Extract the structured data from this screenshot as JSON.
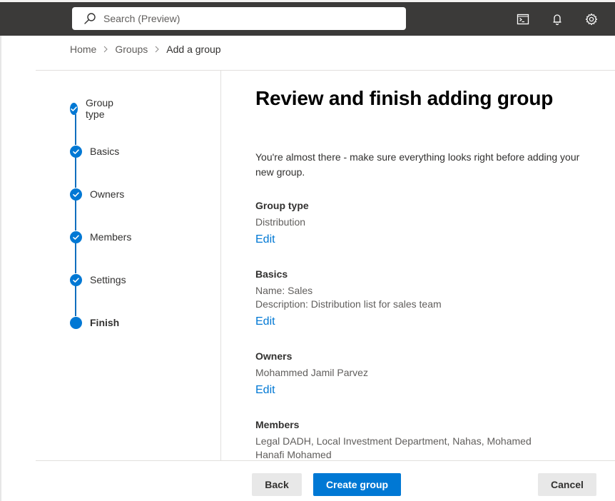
{
  "topbar": {
    "search": {
      "placeholder": "Search (Preview)",
      "icon": "search-icon"
    },
    "icons": [
      {
        "name": "cloud-shell-icon",
        "label": "Cloud shell"
      },
      {
        "name": "notifications-bell-icon",
        "label": "Notifications"
      },
      {
        "name": "settings-gear-icon",
        "label": "Settings"
      }
    ]
  },
  "breadcrumb": {
    "items": [
      "Home",
      "Groups",
      "Add a group"
    ],
    "separator_icon": "chevron-right-icon"
  },
  "wizard": {
    "steps": [
      {
        "label": "Group type",
        "status": "completed"
      },
      {
        "label": "Basics",
        "status": "completed"
      },
      {
        "label": "Owners",
        "status": "completed"
      },
      {
        "label": "Members",
        "status": "completed"
      },
      {
        "label": "Settings",
        "status": "completed"
      },
      {
        "label": "Finish",
        "status": "current"
      }
    ]
  },
  "content": {
    "title": "Review and finish adding group",
    "intro": "You're almost there - make sure everything looks right before adding your new group.",
    "sections": [
      {
        "heading": "Group type",
        "values": [
          "Distribution"
        ],
        "edit_label": "Edit"
      },
      {
        "heading": "Basics",
        "values": [
          "Name: Sales",
          "Description: Distribution list for sales team"
        ],
        "edit_label": "Edit"
      },
      {
        "heading": "Owners",
        "values": [
          "Mohammed Jamil Parvez"
        ],
        "edit_label": "Edit"
      },
      {
        "heading": "Members",
        "values": [
          "Legal DADH, Local Investment Department, Nahas, Mohamed Hanafi Mohamed"
        ]
      }
    ]
  },
  "footer": {
    "back_label": "Back",
    "create_label": "Create group",
    "cancel_label": "Cancel"
  },
  "colors": {
    "accent": "#0078d4",
    "topbar_bg": "#3b3a39",
    "connector": "#106ebe"
  }
}
